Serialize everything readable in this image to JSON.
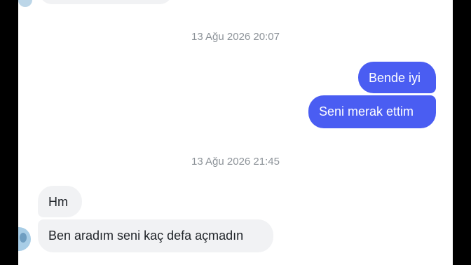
{
  "conversation": {
    "timestamps": [
      "13 Ağu 2026 20:07",
      "13 Ağu 2026 21:45"
    ],
    "messages": [
      {
        "direction": "outgoing",
        "text": "Bende iyi"
      },
      {
        "direction": "outgoing",
        "text": "Seni merak ettim"
      },
      {
        "direction": "incoming",
        "text": "Hm"
      },
      {
        "direction": "incoming",
        "text": "Ben aradım seni kaç defa açmadın"
      }
    ]
  },
  "colors": {
    "outgoing_bubble": "#4a5df2",
    "incoming_bubble": "#f1f2f4",
    "timestamp_text": "#8d9399"
  }
}
